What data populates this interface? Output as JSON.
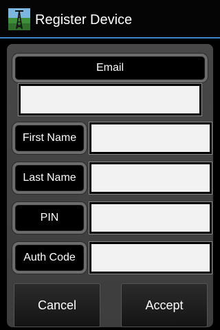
{
  "app": {
    "title": "Register Device",
    "icon": "oil-derrick-icon"
  },
  "form": {
    "email": {
      "label": "Email",
      "value": ""
    },
    "first_name": {
      "label": "First Name",
      "value": ""
    },
    "last_name": {
      "label": "Last Name",
      "value": ""
    },
    "pin": {
      "label": "PIN",
      "value": ""
    },
    "auth_code": {
      "label": "Auth Code",
      "value": ""
    }
  },
  "buttons": {
    "cancel": "Cancel",
    "accept": "Accept"
  },
  "colors": {
    "accent": "#3e86c9",
    "panel": "#444444",
    "field": "#f2f2f2"
  }
}
